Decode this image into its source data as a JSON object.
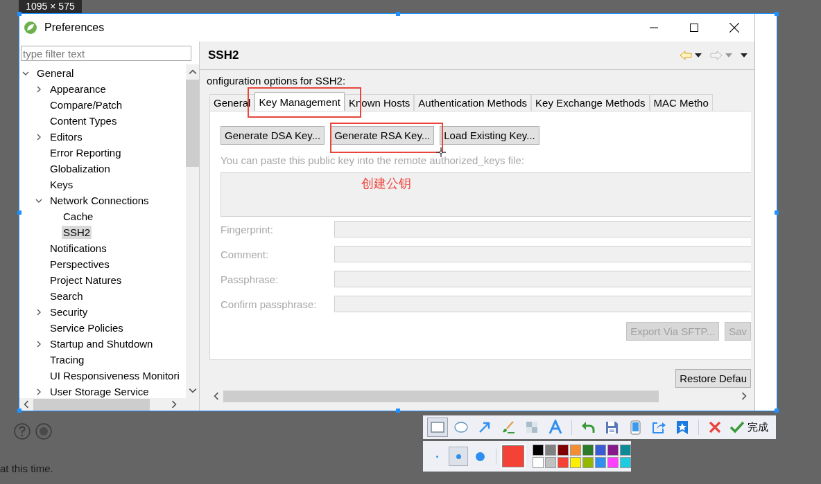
{
  "capture": {
    "size_label": "1095 × 575"
  },
  "dialog": {
    "title": "Preferences",
    "filter": {
      "placeholder": "type filter text"
    },
    "tree": [
      {
        "label": "General",
        "expanded": true,
        "selected": false,
        "children": [
          {
            "label": "Appearance",
            "expanded": false,
            "selected": false
          },
          {
            "label": "Compare/Patch",
            "selected": false
          },
          {
            "label": "Content Types",
            "selected": false
          },
          {
            "label": "Editors",
            "expanded": false,
            "selected": false
          },
          {
            "label": "Error Reporting",
            "selected": false
          },
          {
            "label": "Globalization",
            "selected": false
          },
          {
            "label": "Keys",
            "selected": false
          },
          {
            "label": "Network Connections",
            "expanded": true,
            "selected": false,
            "children": [
              {
                "label": "Cache",
                "selected": false
              },
              {
                "label": "SSH2",
                "selected": true
              }
            ]
          },
          {
            "label": "Notifications",
            "selected": false
          },
          {
            "label": "Perspectives",
            "selected": false
          },
          {
            "label": "Project Natures",
            "selected": false
          },
          {
            "label": "Search",
            "selected": false
          },
          {
            "label": "Security",
            "expanded": false,
            "selected": false
          },
          {
            "label": "Service Policies",
            "selected": false
          },
          {
            "label": "Startup and Shutdown",
            "expanded": false,
            "selected": false
          },
          {
            "label": "Tracing",
            "selected": false
          },
          {
            "label": "UI Responsiveness Monitori",
            "selected": false
          },
          {
            "label": "User Storage Service",
            "expanded": false,
            "selected": false
          }
        ]
      }
    ],
    "page": {
      "title": "SSH2",
      "description": "onfiguration options for SSH2:",
      "tabs": [
        {
          "label": "General",
          "selected": false
        },
        {
          "label": "Key Management",
          "selected": true
        },
        {
          "label": "Known Hosts",
          "selected": false
        },
        {
          "label": "Authentication Methods",
          "selected": false
        },
        {
          "label": "Key Exchange Methods",
          "selected": false
        },
        {
          "label": "MAC Metho",
          "selected": false
        }
      ],
      "key_buttons": [
        {
          "label": "Generate DSA Key...",
          "disabled": false
        },
        {
          "label": "Generate RSA Key...",
          "disabled": false
        },
        {
          "label": "Load Existing Key...",
          "disabled": false
        }
      ],
      "public_key_label": {
        "text": "You can paste this public key into the remote authorized_keys file:",
        "disabled": true
      },
      "fields": [
        {
          "label": "Fingerprint:",
          "disabled": true
        },
        {
          "label": "Comment:",
          "disabled": true
        },
        {
          "label": "Passphrase:",
          "disabled": true
        },
        {
          "label": "Confirm passphrase:",
          "disabled": true
        }
      ],
      "actions": [
        {
          "label": "Export Via SFTP...",
          "disabled": true
        },
        {
          "label": "Sav",
          "disabled": true
        }
      ],
      "restore_button": "Restore Defau"
    }
  },
  "annotation": {
    "text": "创建公钥"
  },
  "toolbar": {
    "tools": [
      {
        "kind": "rectangle",
        "selected": true
      },
      {
        "kind": "ellipse",
        "selected": false
      },
      {
        "kind": "arrow",
        "selected": false
      },
      {
        "kind": "brush",
        "selected": false
      },
      {
        "kind": "mosaic",
        "selected": false
      },
      {
        "kind": "text",
        "selected": false
      },
      {
        "kind": "undo",
        "selected": false
      },
      {
        "kind": "save",
        "selected": false
      },
      {
        "kind": "pin",
        "selected": false
      },
      {
        "kind": "share",
        "selected": false
      },
      {
        "kind": "bookmark",
        "selected": false
      },
      {
        "kind": "cancel",
        "selected": false
      },
      {
        "kind": "done",
        "selected": false,
        "label": "完成"
      }
    ],
    "sizes": [
      {
        "kind": "small",
        "selected": false
      },
      {
        "kind": "medium",
        "selected": true
      },
      {
        "kind": "large",
        "selected": false
      }
    ],
    "current_swatch": {
      "color": "#f44336"
    },
    "palette": [
      {
        "color": "#000000"
      },
      {
        "color": "#808080"
      },
      {
        "color": "#800000"
      },
      {
        "color": "#f58d32"
      },
      {
        "color": "#2a7a2a"
      },
      {
        "color": "#3a5bd6"
      },
      {
        "color": "#861a8a"
      },
      {
        "color": "#0e8a96"
      },
      {
        "color": "#ffffff"
      },
      {
        "color": "#c0c0c0"
      },
      {
        "color": "#f44336"
      },
      {
        "color": "#ffee00"
      },
      {
        "color": "#94b800"
      },
      {
        "color": "#2f8ff0"
      },
      {
        "color": "#ff40ff"
      },
      {
        "color": "#1ecce0"
      }
    ]
  },
  "background": {
    "text": "at this time."
  }
}
